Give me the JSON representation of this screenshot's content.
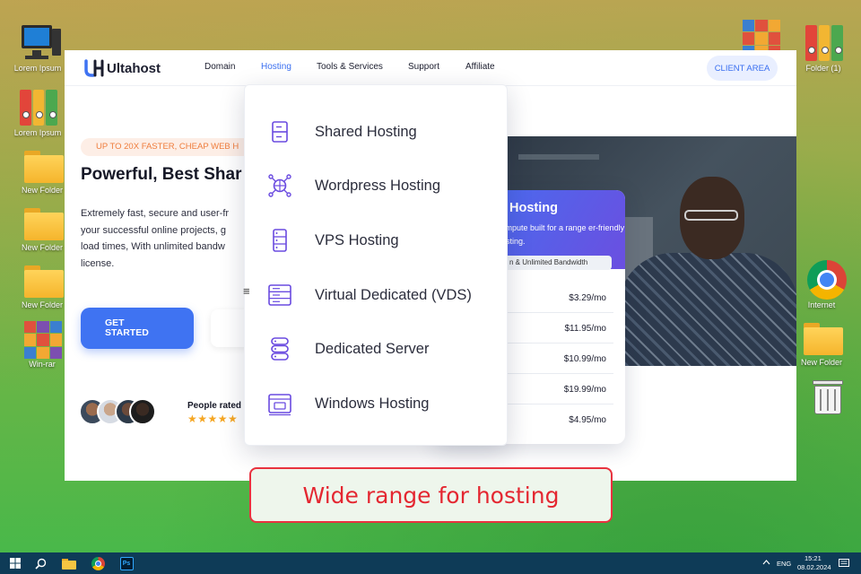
{
  "desktop": {
    "left_icons": [
      {
        "label": "Lorem Ipsum",
        "icon": "computer-icon"
      },
      {
        "label": "Lorem Ipsum",
        "icon": "binders-icon"
      },
      {
        "label": "New Folder",
        "icon": "folder-icon"
      },
      {
        "label": "New Folder",
        "icon": "folder-icon"
      },
      {
        "label": "New Folder",
        "icon": "folder-icon"
      },
      {
        "label": "Win-rar",
        "icon": "winrar-icon"
      }
    ],
    "right_icons": [
      {
        "label": "",
        "icon": "winrar-icon"
      },
      {
        "label": "Folder (1)",
        "icon": "binders-icon"
      },
      {
        "label": "Internet",
        "icon": "chrome-icon"
      },
      {
        "label": "New Folder",
        "icon": "folder-icon"
      },
      {
        "label": "",
        "icon": "recycle-bin-icon"
      }
    ]
  },
  "site": {
    "logo_text": "Ultahost",
    "nav": [
      "Domain",
      "Hosting",
      "Tools & Services",
      "Support",
      "Affiliate"
    ],
    "active_nav": "Hosting",
    "client_area": "CLIENT AREA",
    "promo_badge": "UP TO 20X FASTER, CHEAP WEB H",
    "hero_title": "Powerful, Best Shar",
    "hero_lines": [
      "Extremely fast, secure and user-fr",
      "your successful online projects, g",
      "load times, With unlimited bandw",
      "license."
    ],
    "cta": "GET\nSTARTED",
    "people_rated": "People rated",
    "stars": "★★★★★",
    "plan_card": {
      "title": "Hosting",
      "subtitle": "compute built for a range er-friendly hosting.",
      "pill": "n & Unlimited Bandwidth",
      "prices": [
        "$3.29/mo",
        "$11.95/mo",
        "$10.99/mo",
        "$19.99/mo",
        "$4.95/mo"
      ]
    }
  },
  "dropdown": {
    "items": [
      {
        "label": "Shared Hosting",
        "icon": "shared-hosting-icon"
      },
      {
        "label": "Wordpress Hosting",
        "icon": "wordpress-hosting-icon"
      },
      {
        "label": "VPS Hosting",
        "icon": "vps-hosting-icon"
      },
      {
        "label": "Virtual Dedicated (VDS)",
        "icon": "vds-icon"
      },
      {
        "label": "Dedicated Server",
        "icon": "dedicated-server-icon"
      },
      {
        "label": "Windows Hosting",
        "icon": "windows-hosting-icon"
      }
    ],
    "accent": "#6a4be0"
  },
  "caption": "Wide range for hosting",
  "taskbar": {
    "lang": "ENG",
    "time": "15:21",
    "date": "08.02.2024"
  },
  "colors": {
    "brand_blue": "#3f73f2",
    "caption_red": "#e42731",
    "taskbar": "#0e3b57"
  }
}
